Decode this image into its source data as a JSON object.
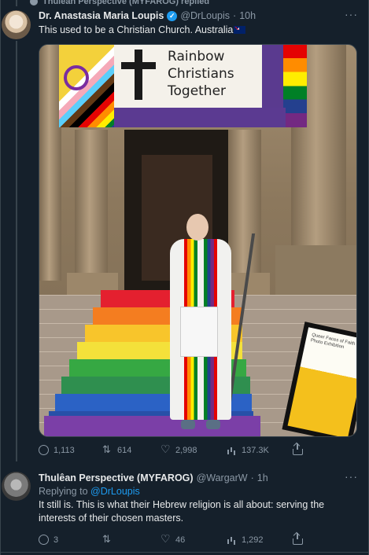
{
  "context_line": "Thulean Perspective (MYFAROG) replied",
  "tweet1": {
    "name": "Dr. Anastasia Maria Loupis",
    "handle": "@DrLoupis",
    "dot": "·",
    "time": "10h",
    "text": "This used to be a Christian Church. Australia",
    "flag_icon": "australia-flag-icon",
    "image": {
      "banner_text": "Rainbow Christians Together",
      "poster_text": "Queer Faces of Faith Photo Exhibition"
    },
    "actions": {
      "replies": "1,113",
      "retweets": "614",
      "likes": "2,998",
      "views": "137.3K"
    }
  },
  "tweet2": {
    "name": "Thulêan Perspective (MYFAROG)",
    "handle": "@WargarW",
    "dot": "·",
    "time": "1h",
    "replying_prefix": "Replying to",
    "replying_to": "@DrLoupis",
    "text": "It still is. This is what their Hebrew religion is all about: serving the interests of their chosen masters.",
    "actions": {
      "replies": "3",
      "retweets": "",
      "likes": "46",
      "views": "1,292"
    }
  },
  "colors": {
    "background": "#15202b",
    "text": "#e7e9ea",
    "muted": "#8b98a5",
    "link": "#1d9bf0"
  }
}
